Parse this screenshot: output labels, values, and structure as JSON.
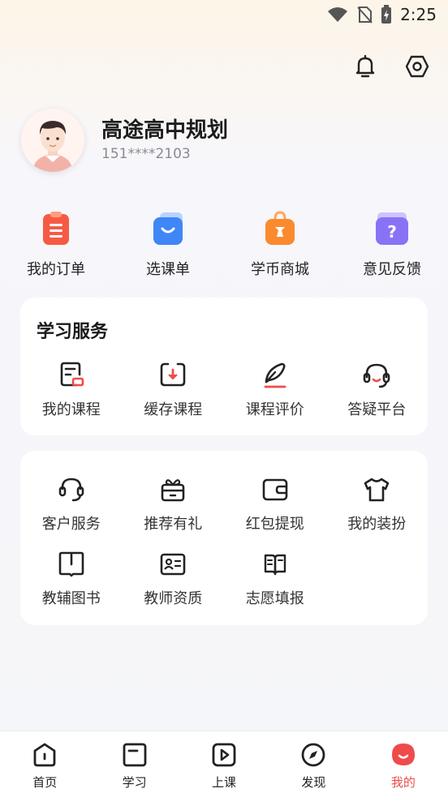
{
  "status": {
    "time": "2:25"
  },
  "profile": {
    "name": "高途高中规划",
    "phone": "151****2103"
  },
  "quick_actions": [
    {
      "label": "我的订单",
      "icon": "order-clipboard-icon"
    },
    {
      "label": "选课单",
      "icon": "course-bag-icon"
    },
    {
      "label": "学币商城",
      "icon": "coin-mall-icon"
    },
    {
      "label": "意见反馈",
      "icon": "feedback-question-icon"
    }
  ],
  "study_services": {
    "title": "学习服务",
    "items": [
      {
        "label": "我的课程",
        "icon": "my-course-icon"
      },
      {
        "label": "缓存课程",
        "icon": "download-cache-icon"
      },
      {
        "label": "课程评价",
        "icon": "pen-review-icon"
      },
      {
        "label": "答疑平台",
        "icon": "headset-qa-icon"
      }
    ]
  },
  "other_services": {
    "row1": [
      {
        "label": "客户服务",
        "icon": "customer-service-icon"
      },
      {
        "label": "推荐有礼",
        "icon": "gift-icon"
      },
      {
        "label": "红包提现",
        "icon": "wallet-icon"
      },
      {
        "label": "我的装扮",
        "icon": "tshirt-icon"
      }
    ],
    "row2": [
      {
        "label": "教辅图书",
        "icon": "book-icon"
      },
      {
        "label": "教师资质",
        "icon": "id-card-icon"
      },
      {
        "label": "志愿填报",
        "icon": "open-book-icon"
      }
    ]
  },
  "tabs": [
    {
      "label": "首页",
      "icon": "home-icon"
    },
    {
      "label": "学习",
      "icon": "study-icon"
    },
    {
      "label": "上课",
      "icon": "play-icon"
    },
    {
      "label": "发现",
      "icon": "compass-icon"
    },
    {
      "label": "我的",
      "icon": "me-icon",
      "active": true
    }
  ],
  "colors": {
    "accent": "#f04b4b",
    "text": "#222222",
    "subtext": "#8a8a94"
  }
}
